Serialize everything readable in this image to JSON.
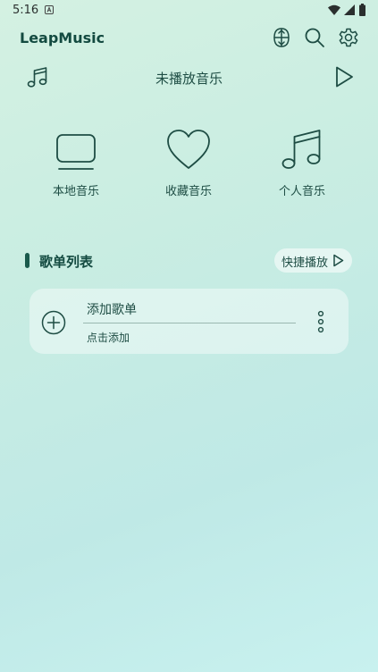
{
  "status_bar": {
    "time": "5:16"
  },
  "header": {
    "app_title": "LeapMusic"
  },
  "now_playing": {
    "title": "未播放音乐"
  },
  "quick_access": [
    {
      "label": "本地音乐",
      "icon": "monitor-icon"
    },
    {
      "label": "收藏音乐",
      "icon": "heart-icon"
    },
    {
      "label": "个人音乐",
      "icon": "music-note-icon"
    }
  ],
  "playlists_section": {
    "title": "歌单列表",
    "quick_play_label": "快捷播放",
    "items": [
      {
        "name": "添加歌单",
        "subtitle": "点击添加"
      }
    ]
  },
  "colors": {
    "accent": "#1a5a4c",
    "text": "#1e4d44"
  }
}
